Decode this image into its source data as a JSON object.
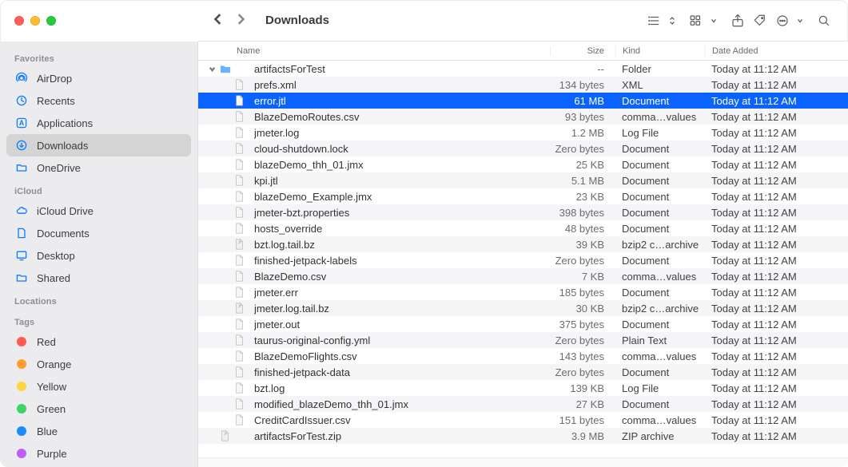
{
  "window": {
    "title": "Downloads"
  },
  "columns": {
    "name": "Name",
    "size": "Size",
    "kind": "Kind",
    "date": "Date Added"
  },
  "sidebar": {
    "sections": {
      "favorites": {
        "title": "Favorites",
        "items": [
          {
            "label": "AirDrop",
            "icon": "airdrop"
          },
          {
            "label": "Recents",
            "icon": "clock"
          },
          {
            "label": "Applications",
            "icon": "apps"
          },
          {
            "label": "Downloads",
            "icon": "download",
            "selected": true
          },
          {
            "label": "OneDrive",
            "icon": "folder"
          }
        ]
      },
      "icloud": {
        "title": "iCloud",
        "items": [
          {
            "label": "iCloud Drive",
            "icon": "cloud"
          },
          {
            "label": "Documents",
            "icon": "doc"
          },
          {
            "label": "Desktop",
            "icon": "desktop"
          },
          {
            "label": "Shared",
            "icon": "shared"
          }
        ]
      },
      "locations": {
        "title": "Locations",
        "items": []
      },
      "tags": {
        "title": "Tags",
        "items": [
          {
            "label": "Red",
            "color": "#ff5b51"
          },
          {
            "label": "Orange",
            "color": "#ff9e2f"
          },
          {
            "label": "Yellow",
            "color": "#ffd53f"
          },
          {
            "label": "Green",
            "color": "#3fd267"
          },
          {
            "label": "Blue",
            "color": "#1f8aff"
          },
          {
            "label": "Purple",
            "color": "#c15bff"
          }
        ]
      }
    }
  },
  "rows": [
    {
      "name": "artifactsForTest",
      "size": "--",
      "kind": "Folder",
      "date": "Today at 11:12 AM",
      "indent": 0,
      "icon": "folder",
      "expanded": true
    },
    {
      "name": "prefs.xml",
      "size": "134 bytes",
      "kind": "XML",
      "date": "Today at 11:12 AM",
      "indent": 1,
      "icon": "doc"
    },
    {
      "name": "error.jtl",
      "size": "61 MB",
      "kind": "Document",
      "date": "Today at 11:12 AM",
      "indent": 1,
      "icon": "doc",
      "selected": true
    },
    {
      "name": "BlazeDemoRoutes.csv",
      "size": "93 bytes",
      "kind": "comma…values",
      "date": "Today at 11:12 AM",
      "indent": 1,
      "icon": "doc"
    },
    {
      "name": "jmeter.log",
      "size": "1.2 MB",
      "kind": "Log File",
      "date": "Today at 11:12 AM",
      "indent": 1,
      "icon": "doc"
    },
    {
      "name": "cloud-shutdown.lock",
      "size": "Zero bytes",
      "kind": "Document",
      "date": "Today at 11:12 AM",
      "indent": 1,
      "icon": "doc"
    },
    {
      "name": "blazeDemo_thh_01.jmx",
      "size": "25 KB",
      "kind": "Document",
      "date": "Today at 11:12 AM",
      "indent": 1,
      "icon": "doc"
    },
    {
      "name": "kpi.jtl",
      "size": "5.1 MB",
      "kind": "Document",
      "date": "Today at 11:12 AM",
      "indent": 1,
      "icon": "doc"
    },
    {
      "name": "blazeDemo_Example.jmx",
      "size": "23 KB",
      "kind": "Document",
      "date": "Today at 11:12 AM",
      "indent": 1,
      "icon": "doc"
    },
    {
      "name": "jmeter-bzt.properties",
      "size": "398 bytes",
      "kind": "Document",
      "date": "Today at 11:12 AM",
      "indent": 1,
      "icon": "doc"
    },
    {
      "name": "hosts_override",
      "size": "48 bytes",
      "kind": "Document",
      "date": "Today at 11:12 AM",
      "indent": 1,
      "icon": "doc"
    },
    {
      "name": "bzt.log.tail.bz",
      "size": "39 KB",
      "kind": "bzip2 c…archive",
      "date": "Today at 11:12 AM",
      "indent": 1,
      "icon": "zip"
    },
    {
      "name": "finished-jetpack-labels",
      "size": "Zero bytes",
      "kind": "Document",
      "date": "Today at 11:12 AM",
      "indent": 1,
      "icon": "doc"
    },
    {
      "name": "BlazeDemo.csv",
      "size": "7 KB",
      "kind": "comma…values",
      "date": "Today at 11:12 AM",
      "indent": 1,
      "icon": "doc"
    },
    {
      "name": "jmeter.err",
      "size": "185 bytes",
      "kind": "Document",
      "date": "Today at 11:12 AM",
      "indent": 1,
      "icon": "doc"
    },
    {
      "name": "jmeter.log.tail.bz",
      "size": "30 KB",
      "kind": "bzip2 c…archive",
      "date": "Today at 11:12 AM",
      "indent": 1,
      "icon": "zip"
    },
    {
      "name": "jmeter.out",
      "size": "375 bytes",
      "kind": "Document",
      "date": "Today at 11:12 AM",
      "indent": 1,
      "icon": "doc"
    },
    {
      "name": "taurus-original-config.yml",
      "size": "Zero bytes",
      "kind": "Plain Text",
      "date": "Today at 11:12 AM",
      "indent": 1,
      "icon": "doc"
    },
    {
      "name": "BlazeDemoFlights.csv",
      "size": "143 bytes",
      "kind": "comma…values",
      "date": "Today at 11:12 AM",
      "indent": 1,
      "icon": "doc"
    },
    {
      "name": "finished-jetpack-data",
      "size": "Zero bytes",
      "kind": "Document",
      "date": "Today at 11:12 AM",
      "indent": 1,
      "icon": "doc"
    },
    {
      "name": "bzt.log",
      "size": "139 KB",
      "kind": "Log File",
      "date": "Today at 11:12 AM",
      "indent": 1,
      "icon": "doc"
    },
    {
      "name": "modified_blazeDemo_thh_01.jmx",
      "size": "27 KB",
      "kind": "Document",
      "date": "Today at 11:12 AM",
      "indent": 1,
      "icon": "doc"
    },
    {
      "name": "CreditCardIssuer.csv",
      "size": "151 bytes",
      "kind": "comma…values",
      "date": "Today at 11:12 AM",
      "indent": 1,
      "icon": "doc"
    },
    {
      "name": "artifactsForTest.zip",
      "size": "3.9 MB",
      "kind": "ZIP archive",
      "date": "Today at 11:12 AM",
      "indent": 0,
      "icon": "zip"
    }
  ]
}
